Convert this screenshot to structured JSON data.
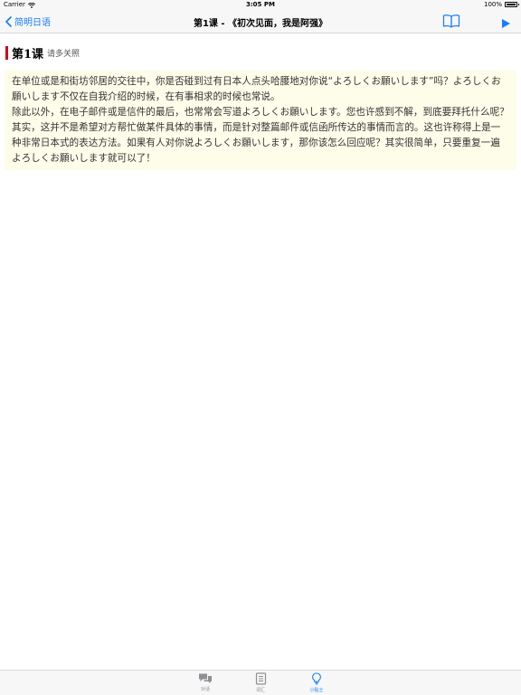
{
  "status_bar": {
    "carrier": "Carrier",
    "time": "3:05 PM",
    "battery": "100%"
  },
  "nav": {
    "back_label": "简明日语",
    "title": "第1课 - 《初次见面，我是阿强》"
  },
  "lesson": {
    "number": "第1课",
    "subtitle": "请多关照"
  },
  "content": {
    "paragraphs": [
      "在单位或是和街坊邻居的交往中，你是否碰到过有日本人点头哈腰地对你说“よろしくお願いします”吗？よろしくお願いします不仅在自我介绍的时候，在有事相求的时候也常说。",
      "除此以外，在电子邮件或是信件的最后，也常常会写道よろしくお願いします。您也许感到不解，到底要拜托什么呢？其实，这并不是希望对方帮忙做某件具体的事情，而是针对整篇邮件或信函所传达的事情而言的。这也许称得上是一种非常日本式的表达方法。如果有人对你说よろしくお願いします，那你该怎么回应呢？其实很简单，只要重复一遍よろしくお願いします就可以了！"
    ]
  },
  "tabs": [
    {
      "label": "对话",
      "icon": "chat-bubbles-icon"
    },
    {
      "label": "词汇",
      "icon": "notebook-icon"
    },
    {
      "label": "小贴士",
      "icon": "lightbulb-icon"
    }
  ],
  "colors": {
    "accent": "#157efb",
    "lesson_marker": "#d0021b",
    "content_background": "#fefde9"
  }
}
